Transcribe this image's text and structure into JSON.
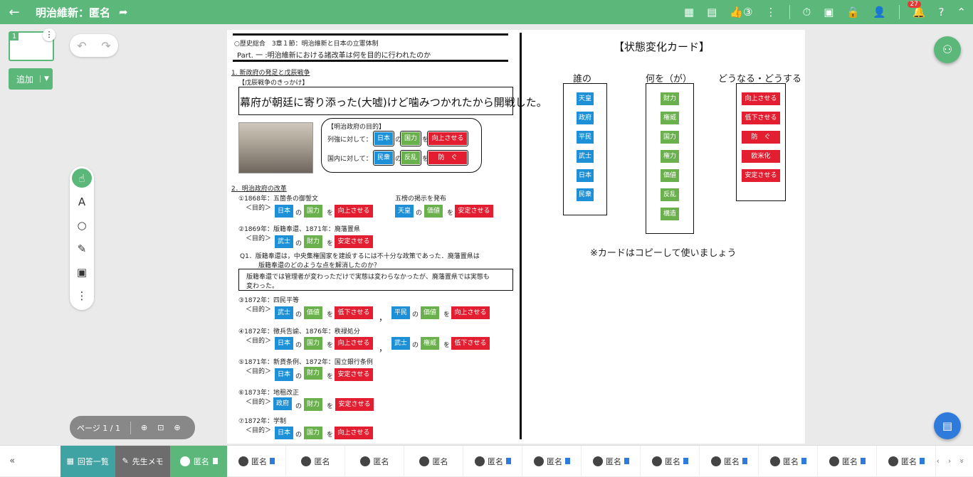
{
  "topbar": {
    "back_icon": "←",
    "title": "明治維新：匿名",
    "share_icon": "➦",
    "like_count": "③",
    "notifications": "27",
    "icons": [
      "presentation-icon",
      "comment-icon",
      "like-icon",
      "more-icon",
      "timer-icon",
      "screen-icon",
      "lock-icon",
      "users-icon",
      "bell-icon",
      "help-icon",
      "collapse-icon"
    ]
  },
  "left": {
    "page_num": "1",
    "add_label": "追加",
    "more": "⋮",
    "dropdown": "▼"
  },
  "undo": {
    "undo": "↶",
    "redo": "↷"
  },
  "tools": {
    "hand": "☝",
    "text": "A",
    "shape": "○",
    "pen": "✎",
    "image": "▣",
    "more": "⋮"
  },
  "zoom": {
    "page": "ページ 1 / 1",
    "zoom_in": "⊕",
    "fit": "⊡",
    "zoom_out": "⊕"
  },
  "doc": {
    "header1": "○歴史総合　3章１節：明治維新と日本の立憲体制",
    "header2": "Part. 一 :明治維新における諸改革は何を目的に行われたのか",
    "s1": "1. 新政府の発足と戊辰戦争",
    "s1sub": "【戊辰戦争のきっかけ】",
    "big": "幕府が朝廷に寄り添った(大嘘)けど噛みつかれたから開戦した。",
    "bubble_title": "【明治政府の目的】",
    "bubble_r1": "列強に対して：",
    "bubble_r2": "国内に対して：",
    "s2": "2．明治政府の改革",
    "i1": "①1868年：五箇条の御誓文",
    "i1b": "五榜の掲示を発布",
    "purpose": "＜目的＞",
    "i2": "②1869年：版籍奉還、1871年：廃藩置県",
    "q1a": "Q1．版籍奉還は，中央集権国家を建設するには不十分な政策であった．廃藩置県は",
    "q1b": "版籍奉還のどのような点を解消したのか？",
    "ans1": "版籍奉還では管理者が変わっただけで実態は変わらなかったが、廃藩置県では実態も",
    "ans2": "変わった。",
    "i3": "③1872年：四民平等",
    "i4": "④1872年：徴兵告諭、1876年：秩禄処分",
    "i5": "⑤1871年：新貨条例、1872年：国立銀行条例",
    "i6": "⑥1873年：地租改正",
    "i7": "⑦1872年：学制",
    "no": "の",
    "wo": "を",
    "comma": "，"
  },
  "cards": {
    "title": "【状態変化カード】",
    "h_who": "誰の",
    "h_what": "何を（が）",
    "h_how": "どうなる・どうする",
    "who": [
      "天皇",
      "政府",
      "平民",
      "武士",
      "日本",
      "民衆"
    ],
    "what": [
      "財力",
      "権威",
      "国力",
      "権力",
      "価値",
      "反乱",
      "構造"
    ],
    "how": [
      "向上させる",
      "低下させる",
      "防　ぐ",
      "欧米化",
      "安定させる"
    ],
    "note": "※カードはコピーして使いましょう"
  },
  "labels": {
    "nihon": "日本",
    "kokuryoku": "国力",
    "koujou": "向上させる",
    "minshu": "民衆",
    "hanran": "反乱",
    "fusegu": "防　ぐ",
    "tennou": "天皇",
    "kachi": "価値",
    "antei": "安定させる",
    "bushi": "武士",
    "zairyoku": "財力",
    "teika": "低下させる",
    "heimin": "平民",
    "ken_i": "権威",
    "seifu": "政府"
  },
  "bottom": {
    "collapse": "«",
    "answers": "回答一覧",
    "memo": "先生メモ",
    "student": "匿名",
    "nav_prev": "‹",
    "nav_next": "›",
    "expand": "»"
  }
}
